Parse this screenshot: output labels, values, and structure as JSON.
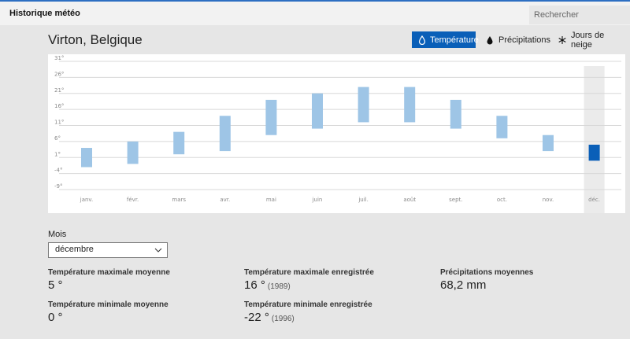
{
  "app": {
    "title": "Historique météo"
  },
  "search": {
    "placeholder": "Rechercher"
  },
  "location": {
    "name": "Virton, Belgique"
  },
  "tabs": [
    {
      "label": "Température",
      "icon": "thermometer-drop-icon",
      "active": true
    },
    {
      "label": "Précipitations",
      "icon": "raindrop-icon",
      "active": false
    },
    {
      "label": "Jours de neige",
      "icon": "snowflake-icon",
      "active": false
    }
  ],
  "colors": {
    "accent": "#0a5fb8",
    "bar": "#9ec5e6",
    "bar_selected": "#0a5fb8"
  },
  "chart_data": {
    "type": "bar",
    "title": "",
    "xlabel": "",
    "ylabel": "",
    "ylim": [
      -9,
      31
    ],
    "yticks": [
      "31°",
      "26°",
      "21°",
      "16°",
      "11°",
      "6°",
      "1°",
      "-4°",
      "-9°"
    ],
    "categories": [
      "janv.",
      "févr.",
      "mars",
      "avr.",
      "mai",
      "juin",
      "juil.",
      "août",
      "sept.",
      "oct.",
      "nov.",
      "déc."
    ],
    "series": [
      {
        "low": [
          -2,
          -1,
          2,
          3,
          8,
          10,
          12,
          12,
          10,
          7,
          3,
          0
        ],
        "high": [
          4,
          6,
          9,
          14,
          19,
          21,
          23,
          23,
          19,
          14,
          8,
          5
        ]
      }
    ],
    "selected": "déc.",
    "grid": true
  },
  "month_select": {
    "label": "Mois",
    "value": "décembre"
  },
  "stats": {
    "avg_max": {
      "label": "Température maximale moyenne",
      "value": "5 °"
    },
    "avg_min": {
      "label": "Température minimale moyenne",
      "value": "0 °"
    },
    "rec_max": {
      "label": "Température maximale enregistrée",
      "value": "16 °",
      "year": "(1989)"
    },
    "rec_min": {
      "label": "Température minimale enregistrée",
      "value": "-22 °",
      "year": "(1996)"
    },
    "precip": {
      "label": "Précipitations moyennes",
      "value": "68,2 mm"
    }
  }
}
